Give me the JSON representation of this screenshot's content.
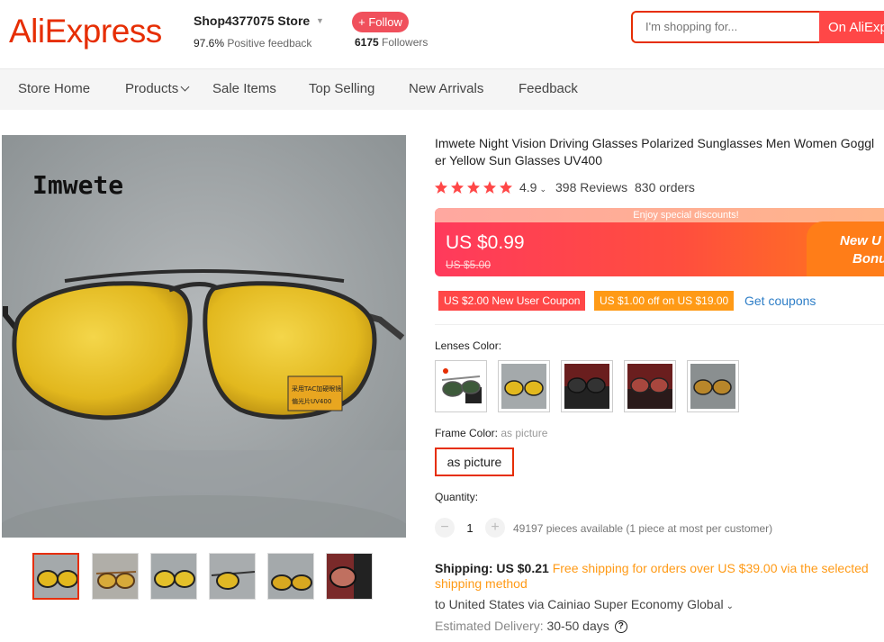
{
  "header": {
    "logo": "AliExpress",
    "store_name": "Shop4377075 Store",
    "feedback_pct": "97.6%",
    "feedback_label": "Positive feedback",
    "follow_label": "+ Follow",
    "followers_count": "6175",
    "followers_label": "Followers",
    "search_placeholder": "I'm shopping for...",
    "search_button": "On AliExp"
  },
  "nav": {
    "items": [
      "Store Home",
      "Products",
      "Sale Items",
      "Top Selling",
      "New Arrivals",
      "Feedback"
    ]
  },
  "gallery": {
    "brand_overlay": "Imwete",
    "lens_sticker_1": "采用TAC加硬眼镜",
    "lens_sticker_2": "偏光片UV400"
  },
  "product": {
    "title": "Imwete Night Vision Driving Glasses Polarized Sunglasses Men Women Goggl er Yellow Sun Glasses UV400",
    "title_line1": "Imwete Night Vision Driving Glasses Polarized Sunglasses Men Women Goggl",
    "title_line2": "er Yellow Sun Glasses UV400",
    "rating": "4.9",
    "stars": 5,
    "reviews": "398 Reviews",
    "orders": "830 orders",
    "enjoy": "Enjoy special discounts!",
    "price": "US $0.99",
    "original_price": "US $5.00",
    "new_bonus_1": "New U",
    "new_bonus_2": "Bonu",
    "coupon_1": "US $2.00 New User Coupon",
    "coupon_2": "US $1.00 off on US $19.00",
    "get_coupons": "Get coupons",
    "lens_color_label": "Lenses Color:",
    "frame_color_label": "Frame Color:",
    "frame_color_value": "as picture",
    "frame_option": "as picture",
    "quantity_label": "Quantity:",
    "quantity_minus": "−",
    "quantity_plus": "+",
    "quantity": "1",
    "available": "49197 pieces available (1 piece at most per customer)",
    "shipping_label": "Shipping: US $0.21",
    "shipping_free": "Free shipping for orders over US $39.00 via the selected shipping method",
    "shipping_dest": "to United States via Cainiao Super Economy Global",
    "delivery_label": "Estimated Delivery:",
    "delivery_value": "30-50 days",
    "help_icon": "?"
  },
  "colors": {
    "accent": "#e62e04",
    "price_gradient_start": "#ff3a5c",
    "price_gradient_end": "#ff7a1a",
    "star": "#ff4747",
    "coupon_red": "#ff4747",
    "coupon_orange": "#ff9a16",
    "link": "#2e7ec7"
  },
  "icons": {
    "chevron": "chevron-down-icon",
    "help": "question-circle-icon",
    "star": "star-icon"
  }
}
